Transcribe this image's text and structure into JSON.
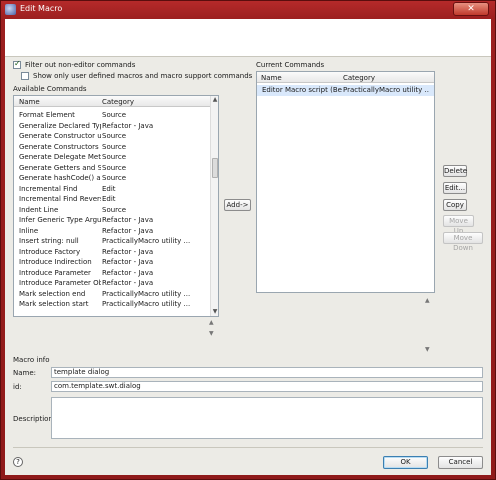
{
  "window": {
    "title": "Edit Macro",
    "close_glyph": "✕"
  },
  "filters": {
    "filter_non_editor": {
      "label": "Filter out non-editor commands",
      "checked": true
    },
    "show_user_defined": {
      "label": "Show only user defined macros and macro support commands",
      "checked": false
    }
  },
  "available": {
    "title": "Available Commands",
    "columns": [
      "Name",
      "Category"
    ],
    "rows": [
      [
        "Format Element",
        "Source"
      ],
      [
        "Generalize Declared Type",
        "Refactor - Java"
      ],
      [
        "Generate Constructor usi...",
        "Source"
      ],
      [
        "Generate Constructors fr...",
        "Source"
      ],
      [
        "Generate Delegate Meth...",
        "Source"
      ],
      [
        "Generate Getters and Set...",
        "Source"
      ],
      [
        "Generate hashCode() an...",
        "Source"
      ],
      [
        "Incremental Find",
        "Edit"
      ],
      [
        "Incremental Find Reverse",
        "Edit"
      ],
      [
        "Indent Line",
        "Source"
      ],
      [
        "Infer Generic Type Argu...",
        "Refactor - Java"
      ],
      [
        "Inline",
        "Refactor - Java"
      ],
      [
        "Insert string: null",
        "PracticallyMacro utility ..."
      ],
      [
        "Introduce Factory",
        "Refactor - Java"
      ],
      [
        "Introduce Indirection",
        "Refactor - Java"
      ],
      [
        "Introduce Parameter",
        "Refactor - Java"
      ],
      [
        "Introduce Parameter Obj...",
        "Refactor - Java"
      ],
      [
        "Mark selection end",
        "PracticallyMacro utility ..."
      ],
      [
        "Mark selection start",
        "PracticallyMacro utility ..."
      ]
    ]
  },
  "add_button": "Add->",
  "current": {
    "title": "Current Commands",
    "columns": [
      "Name",
      "Category"
    ],
    "rows": [
      [
        "Editor Macro script (Bea...",
        "PracticallyMacro utility ..."
      ]
    ]
  },
  "side_buttons": {
    "delete": "Delete",
    "edit": "Edit...",
    "copy": "Copy",
    "move_up": "Move Up",
    "move_down": "Move Down"
  },
  "macro_info": {
    "title": "Macro info",
    "name_label": "Name:",
    "name_value": "template dialog",
    "id_label": "id:",
    "id_value": "com.template.swt.dialog",
    "description_label": "Description:",
    "description_value": ""
  },
  "footer": {
    "help": "?",
    "ok": "OK",
    "cancel": "Cancel"
  },
  "scroll_arrows": {
    "up": "▲",
    "down": "▼"
  }
}
